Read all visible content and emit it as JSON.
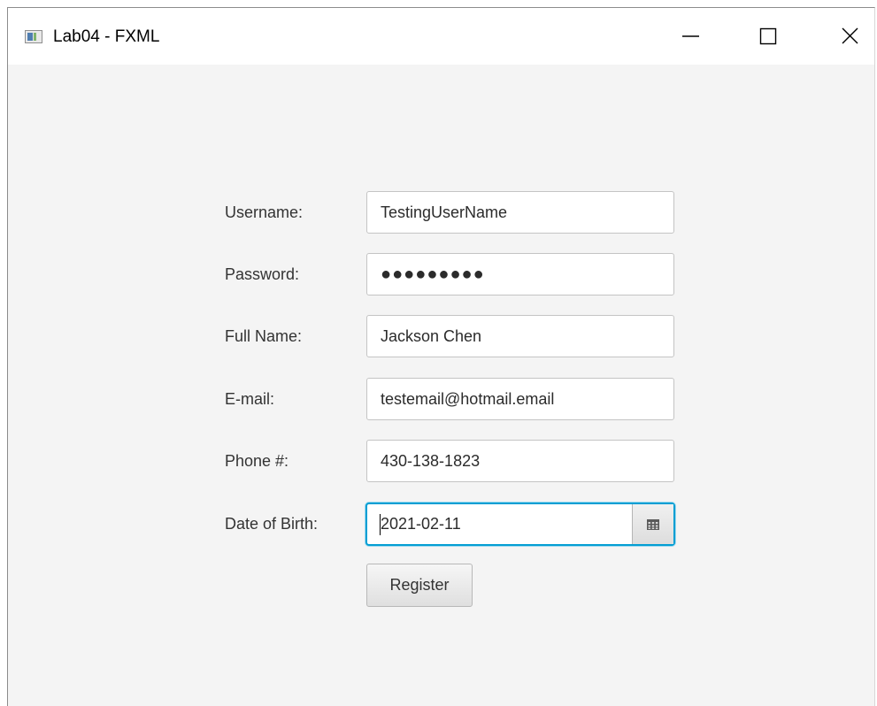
{
  "window": {
    "title": "Lab04 - FXML"
  },
  "form": {
    "username_label": "Username:",
    "username_value": "TestingUserName",
    "password_label": "Password:",
    "password_value": "●●●●●●●●●",
    "fullname_label": "Full Name:",
    "fullname_value": "Jackson Chen",
    "email_label": "E-mail:",
    "email_value": "testemail@hotmail.email",
    "phone_label": "Phone #:",
    "phone_value": "430-138-1823",
    "dob_label": "Date of Birth:",
    "dob_value": "2021-02-11",
    "register_label": "Register"
  },
  "icons": {
    "app": "application-icon",
    "minimize": "minimize-icon",
    "maximize": "maximize-icon",
    "close": "close-icon",
    "calendar": "calendar-icon"
  },
  "colors": {
    "focus_border": "#039ed3",
    "background": "#f4f4f4"
  }
}
